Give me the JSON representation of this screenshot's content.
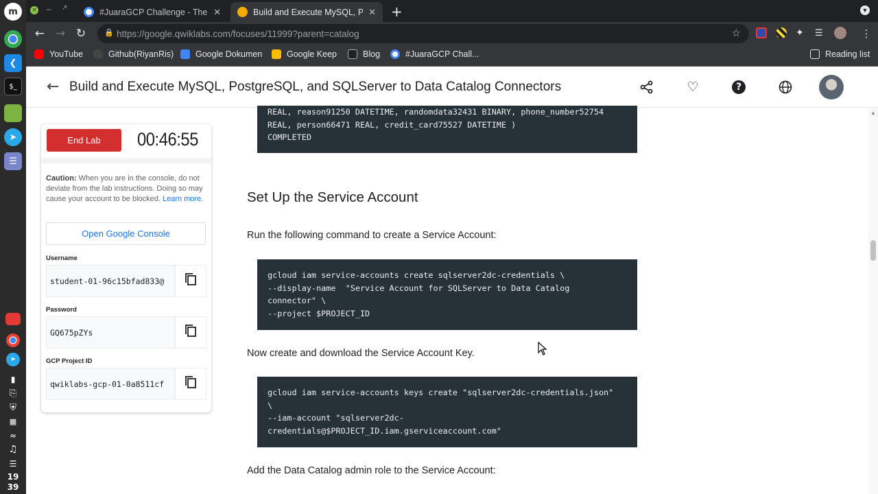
{
  "dock": {
    "clock": [
      "19",
      "39"
    ]
  },
  "browser": {
    "tabs": [
      {
        "title": "#JuaraGCP Challenge - The C",
        "active": false
      },
      {
        "title": "Build and Execute MySQL, Po",
        "active": true
      }
    ],
    "url": "https://google.qwiklabs.com/focuses/11999?parent=catalog",
    "bookmarks": [
      "YouTube",
      "Github(RiyanRis)",
      "Google Dokumen",
      "Google Keep",
      "Blog",
      "#JuaraGCP Chall..."
    ],
    "reading_list": "Reading list"
  },
  "header": {
    "title": "Build and Execute MySQL, PostgreSQL, and SQLServer to Data Catalog Connectors",
    "icons": [
      "share-icon",
      "heart-icon",
      "help-icon",
      "globe-icon"
    ]
  },
  "lab_panel": {
    "end_lab": "End Lab",
    "timer": "00:46:55",
    "caution_title": "Caution:",
    "caution_text": " When you are in the console, do not deviate from the lab instructions. Doing so may cause your account to be blocked.",
    "learn_more": "Learn more.",
    "open_console": "Open Google Console",
    "username_label": "Username",
    "username": "student-01-96c15bfad833@",
    "password_label": "Password",
    "password": "GQ675pZYs",
    "project_label": "GCP Project ID",
    "project_id": "qwiklabs-gcp-01-0a8511cf"
  },
  "content": {
    "code_top": "REAL, reason91250 DATETIME, randomdata32431 BINARY, phone_number52754\nREAL, person66471 REAL, credit_card75527 DATETIME )\nCOMPLETED",
    "heading": "Set Up the Service Account",
    "para1": "Run the following command to create a Service Account:",
    "code1": "gcloud iam service-accounts create sqlserver2dc-credentials \\\n--display-name  \"Service Account for SQLServer to Data Catalog\nconnector\" \\\n--project $PROJECT_ID",
    "para2": "Now create and download the Service Account Key.",
    "code2": "gcloud iam service-accounts keys create \"sqlserver2dc-credentials.json\"\n\\\n--iam-account \"sqlserver2dc-\ncredentials@$PROJECT_ID.iam.gserviceaccount.com\"",
    "para3": "Add the Data Catalog admin role to the Service Account:"
  },
  "colors": {
    "accent": "#1a73e8",
    "end_lab": "#d32f2f",
    "code_bg": "#263238"
  }
}
